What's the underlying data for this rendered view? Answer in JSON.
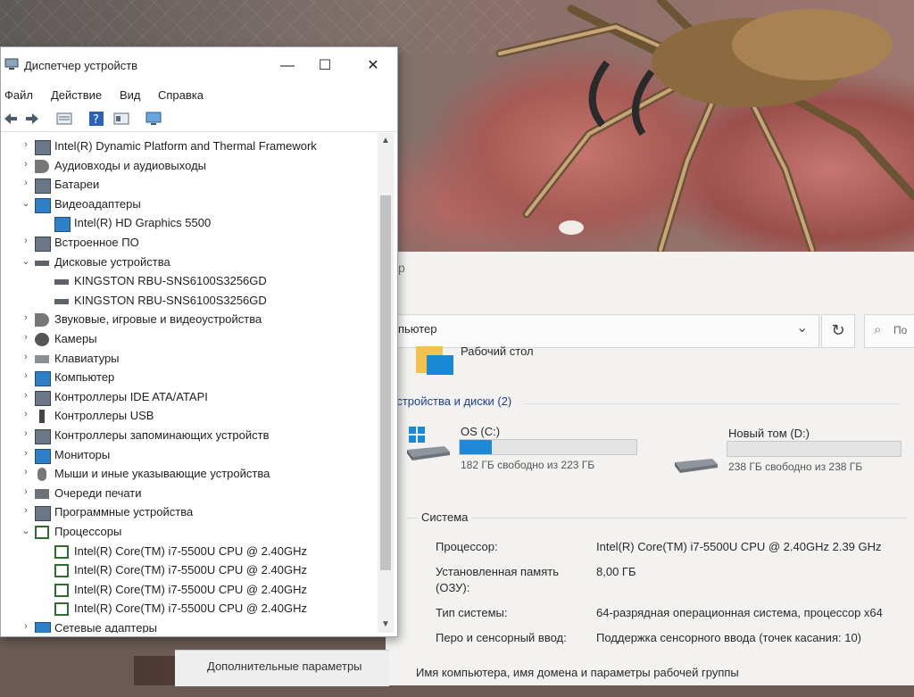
{
  "device_manager": {
    "title": "Диспетчер устройств",
    "window_controls": {
      "minimize": "—",
      "maximize": "☐",
      "close": "✕"
    },
    "menu": [
      "Файл",
      "Действие",
      "Вид",
      "Справка"
    ],
    "tree": [
      {
        "label": "Intel(R) Dynamic Platform and Thermal Framework",
        "level": 0,
        "expanded": false,
        "icon": "chip-icon"
      },
      {
        "label": "Аудиовходы и аудиовыходы",
        "level": 0,
        "expanded": false,
        "icon": "speaker-icon"
      },
      {
        "label": "Батареи",
        "level": 0,
        "expanded": false,
        "icon": "battery-icon"
      },
      {
        "label": "Видеоадаптеры",
        "level": 0,
        "expanded": true,
        "icon": "monitor-icon"
      },
      {
        "label": "Intel(R) HD Graphics 5500",
        "level": 1,
        "icon": "monitor-icon"
      },
      {
        "label": "Встроенное ПО",
        "level": 0,
        "expanded": false,
        "icon": "chip-icon"
      },
      {
        "label": "Дисковые устройства",
        "level": 0,
        "expanded": true,
        "icon": "drive-icon"
      },
      {
        "label": "KINGSTON RBU-SNS6100S3256GD",
        "level": 1,
        "icon": "drive-icon"
      },
      {
        "label": "KINGSTON RBU-SNS6100S3256GD",
        "level": 1,
        "icon": "drive-icon"
      },
      {
        "label": "Звуковые, игровые и видеоустройства",
        "level": 0,
        "expanded": false,
        "icon": "speaker-icon"
      },
      {
        "label": "Камеры",
        "level": 0,
        "expanded": false,
        "icon": "camera-icon"
      },
      {
        "label": "Клавиатуры",
        "level": 0,
        "expanded": false,
        "icon": "keyboard-icon"
      },
      {
        "label": "Компьютер",
        "level": 0,
        "expanded": false,
        "icon": "monitor-icon"
      },
      {
        "label": "Контроллеры IDE ATA/ATAPI",
        "level": 0,
        "expanded": false,
        "icon": "chip-icon"
      },
      {
        "label": "Контроллеры USB",
        "level": 0,
        "expanded": false,
        "icon": "usb-icon"
      },
      {
        "label": "Контроллеры запоминающих устройств",
        "level": 0,
        "expanded": false,
        "icon": "chip-icon"
      },
      {
        "label": "Мониторы",
        "level": 0,
        "expanded": false,
        "icon": "monitor-icon"
      },
      {
        "label": "Мыши и иные указывающие устройства",
        "level": 0,
        "expanded": false,
        "icon": "mouse-icon"
      },
      {
        "label": "Очереди печати",
        "level": 0,
        "expanded": false,
        "icon": "printer-icon"
      },
      {
        "label": "Программные устройства",
        "level": 0,
        "expanded": false,
        "icon": "chip-icon"
      },
      {
        "label": "Процессоры",
        "level": 0,
        "expanded": true,
        "icon": "cpu-icon"
      },
      {
        "label": "Intel(R) Core(TM) i7-5500U CPU @ 2.40GHz",
        "level": 1,
        "icon": "cpu-icon"
      },
      {
        "label": "Intel(R) Core(TM) i7-5500U CPU @ 2.40GHz",
        "level": 1,
        "icon": "cpu-icon"
      },
      {
        "label": "Intel(R) Core(TM) i7-5500U CPU @ 2.40GHz",
        "level": 1,
        "icon": "cpu-icon"
      },
      {
        "label": "Intel(R) Core(TM) i7-5500U CPU @ 2.40GHz",
        "level": 1,
        "icon": "cpu-icon"
      },
      {
        "label": "Сетевые адаптеры",
        "level": 0,
        "expanded": false,
        "icon": "network-icon"
      }
    ]
  },
  "explorer": {
    "title_fragment": "р",
    "address_path": "мпьютер",
    "search_placeholder": "По",
    "desktop_item": "Рабочий стол",
    "devices_section": "устройства и диски (2)",
    "drives": [
      {
        "name": "OS (C:)",
        "free_text": "182 ГБ свободно из 223 ГБ",
        "used_fraction": 0.18
      },
      {
        "name": "Новый том (D:)",
        "free_text": "238 ГБ свободно из 238 ГБ",
        "used_fraction": 0.0
      }
    ],
    "system": {
      "caption": "Система",
      "rows": [
        {
          "label": "Процессор:",
          "value": "Intel(R) Core(TM) i7-5500U CPU @ 2.40GHz   2.39 GHz"
        },
        {
          "label": "Установленная память",
          "value": "8,00 ГБ"
        },
        {
          "label": "(ОЗУ):",
          "value": ""
        },
        {
          "label": "Тип системы:",
          "value": "64-разрядная операционная система, процессор x64"
        },
        {
          "label": "Перо и сенсорный ввод:",
          "value": "Поддержка сенсорного ввода (точек касания: 10)"
        }
      ],
      "footer": "Имя компьютера, имя домена и параметры рабочей группы"
    },
    "behind_link": "Дополнительные параметры"
  },
  "colors": {
    "accent": "#1f89d7",
    "link": "#1c3f8f"
  }
}
